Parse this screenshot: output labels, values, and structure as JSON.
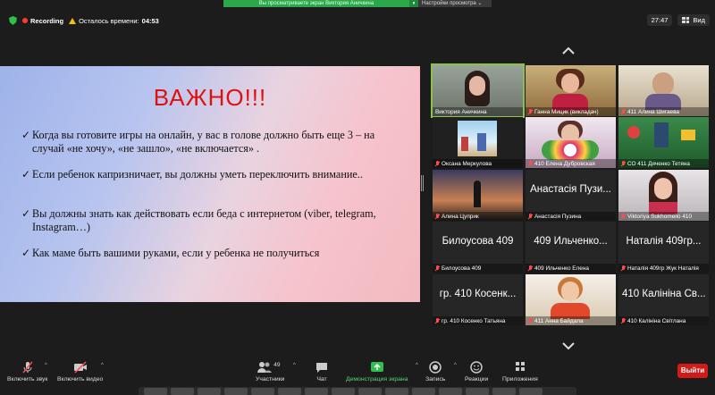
{
  "banner": {
    "sharing_text": "Вы просматриваете экран Виктория Аничкина",
    "settings_label": "Настройки просмотра"
  },
  "status": {
    "recording_label": "Recording",
    "time_left_label": "Осталось времени:",
    "time_left_value": "04:53"
  },
  "top_right": {
    "clock": "27:47",
    "view_label": "Вид"
  },
  "slide": {
    "title": "ВАЖНО!!!",
    "bullets": [
      "Когда вы готовите игры на онлайн, у вас в голове должно быть еще 3 – на случай «не хочу», «не зашло», «не включается» .",
      "Если ребенок капризничает, вы должны уметь переключить внимание..",
      "Вы должны знать как действовать если беда с интернетом (viber, telegram, Instagram…)",
      "Как маме быть вашими руками, если у ребенка не получиться"
    ]
  },
  "participants": [
    {
      "name": "Виктория Аничкина",
      "big": "",
      "muted": false,
      "video": "woman-dark",
      "active": true
    },
    {
      "name": "Ганна Мицик (викладач)",
      "big": "",
      "muted": true,
      "video": "woman-red",
      "active": false
    },
    {
      "name": "411 Алина Шигаева",
      "big": "",
      "muted": true,
      "video": "woman-light",
      "active": false
    },
    {
      "name": "Оксана Меркулова",
      "big": "",
      "muted": true,
      "video": "picture-city",
      "active": false
    },
    {
      "name": "410 Елена Дубровская",
      "big": "",
      "muted": true,
      "video": "woman-flowers",
      "active": false
    },
    {
      "name": "СО 411 Дяченко Тетяна",
      "big": "",
      "muted": true,
      "video": "garden",
      "active": false
    },
    {
      "name": "Алина Цуприк",
      "big": "",
      "muted": true,
      "video": "sunset",
      "active": false
    },
    {
      "name": "Анастасія Пузина",
      "big": "Анастасія Пузи...",
      "muted": true,
      "video": "",
      "active": false
    },
    {
      "name": "Viktoriya Sukhomeilo 410",
      "big": "",
      "muted": true,
      "video": "woman-smile",
      "active": false
    },
    {
      "name": "Билоусова 409",
      "big": "Билоусова 409",
      "muted": true,
      "video": "",
      "active": false
    },
    {
      "name": "409 Ильченко Елена",
      "big": "409 Ильченко...",
      "muted": true,
      "video": "",
      "active": false
    },
    {
      "name": "Наталія 409гр Жук Наталія",
      "big": "Наталія 409гр...",
      "muted": true,
      "video": "",
      "active": false
    },
    {
      "name": "гр. 410 Косенко Татьяна",
      "big": "гр. 410 Косенк...",
      "muted": true,
      "video": "",
      "active": false
    },
    {
      "name": "411 Анна Байдала",
      "big": "",
      "muted": true,
      "video": "woman-orange",
      "active": false
    },
    {
      "name": "410 Калініна Світлана",
      "big": "410 Калініна Св...",
      "muted": true,
      "video": "",
      "active": false
    }
  ],
  "toolbar": {
    "audio_label": "Включить звук",
    "video_label": "Включить видео",
    "participants_label": "Участники",
    "participants_count": "49",
    "chat_label": "Чат",
    "share_label": "Демонстрация экрана",
    "record_label": "Запись",
    "reactions_label": "Реакции",
    "apps_label": "Приложения",
    "leave_label": "Выйти"
  },
  "colors": {
    "accent_green": "#2aa84a",
    "leave_red": "#d11a1a",
    "slide_title_red": "#e01010",
    "active_speaker": "#8bc34a"
  }
}
